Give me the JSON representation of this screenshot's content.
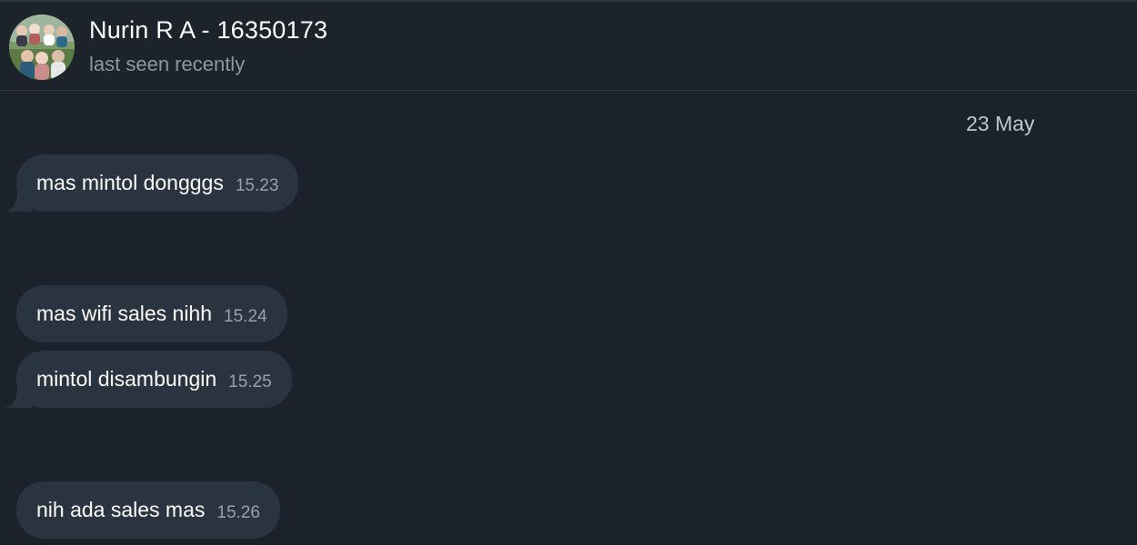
{
  "header": {
    "contact_name": "Nurin R A - 16350173",
    "status": "last seen recently"
  },
  "chat": {
    "date_separator": "23 May",
    "messages": [
      {
        "text": "mas mintol dongggs",
        "time": "15.23",
        "tail": true
      },
      {
        "text": "mas wifi sales nihh",
        "time": "15.24",
        "tail": false
      },
      {
        "text": "mintol disambungin",
        "time": "15.25",
        "tail": true
      },
      {
        "text": "nih ada sales mas",
        "time": "15.26",
        "tail": false
      }
    ]
  },
  "colors": {
    "background": "#1c222b",
    "bubble": "#2a3441",
    "header_divider": "#2f3a46",
    "secondary_text": "#8e98a4"
  },
  "icons": {
    "avatar": "group-photo-avatar"
  }
}
